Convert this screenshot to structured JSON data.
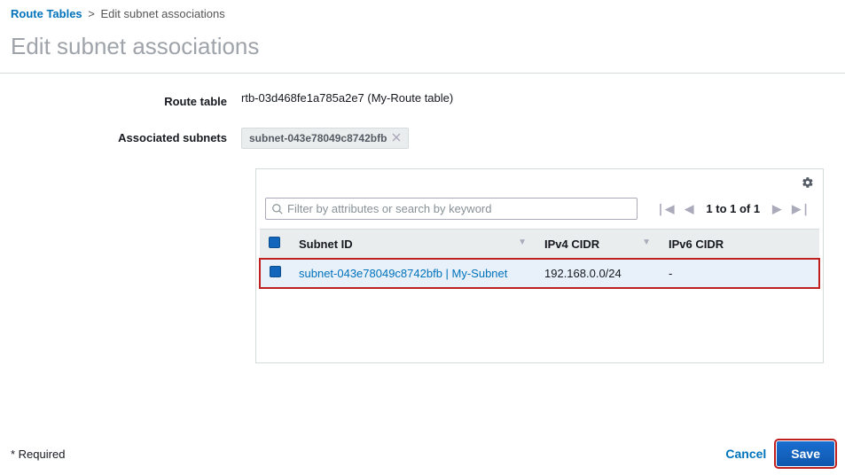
{
  "breadcrumb": {
    "root": "Route Tables",
    "sep": ">",
    "current": "Edit subnet associations"
  },
  "page_title": "Edit subnet associations",
  "fields": {
    "route_table_label": "Route table",
    "route_table_value": "rtb-03d468fe1a785a2e7 (My-Route table)",
    "assoc_subnets_label": "Associated subnets",
    "assoc_subnets_chip": "subnet-043e78049c8742bfb"
  },
  "search": {
    "placeholder": "Filter by attributes or search by keyword"
  },
  "pager": {
    "text": "1 to 1 of 1"
  },
  "table": {
    "headers": {
      "subnet_id": "Subnet ID",
      "ipv4": "IPv4 CIDR",
      "ipv6": "IPv6 CIDR"
    },
    "rows": [
      {
        "subnet": "subnet-043e78049c8742bfb | My-Subnet",
        "ipv4": "192.168.0.0/24",
        "ipv6": "-",
        "checked": true
      }
    ]
  },
  "footer": {
    "required": "* Required",
    "cancel": "Cancel",
    "save": "Save"
  }
}
